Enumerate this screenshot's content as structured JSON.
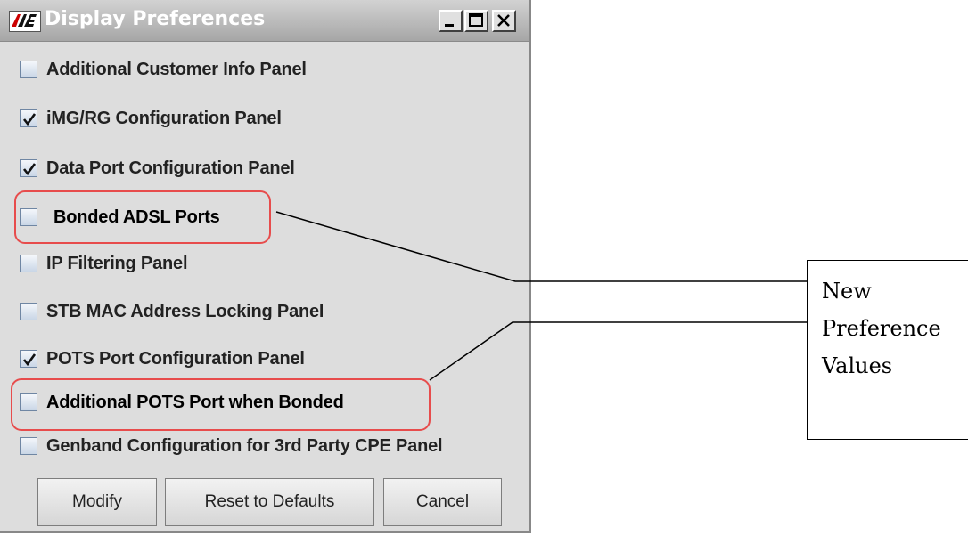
{
  "window": {
    "title": "Display Preferences",
    "title_bar_buttons": [
      "minimize",
      "maximize",
      "close"
    ]
  },
  "preferences": [
    {
      "label": "Additional Customer Info Panel",
      "checked": false
    },
    {
      "label": "iMG/RG Configuration Panel",
      "checked": true
    },
    {
      "label": "Data Port Configuration Panel",
      "checked": true
    },
    {
      "label": "Bonded ADSL Ports",
      "checked": false
    },
    {
      "label": "IP Filtering Panel",
      "checked": false
    },
    {
      "label": "STB MAC Address Locking Panel",
      "checked": false
    },
    {
      "label": "POTS Port Configuration Panel",
      "checked": true
    },
    {
      "label": "Additional POTS Port when Bonded",
      "checked": false
    },
    {
      "label": "Genband Configuration for 3rd Party CPE Panel",
      "checked": false
    }
  ],
  "buttons": {
    "modify": "Modify",
    "reset": "Reset to Defaults",
    "cancel": "Cancel"
  },
  "callout": {
    "lines": [
      "New",
      "Preference",
      "Values"
    ]
  },
  "colors": {
    "highlight": "#e74c4c",
    "window_bg": "#dddddd"
  }
}
